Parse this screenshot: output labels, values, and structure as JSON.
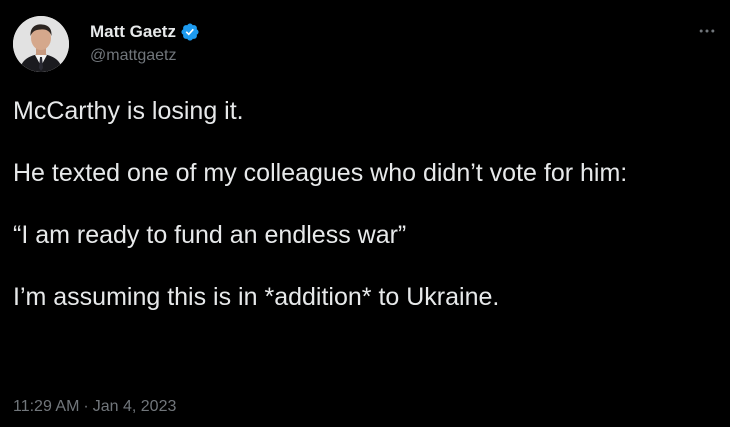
{
  "author": {
    "display_name": "Matt Gaetz",
    "handle": "@mattgaetz",
    "verified": true,
    "avatar_icon": "profile-photo"
  },
  "tweet": {
    "paragraphs": [
      "McCarthy is losing it.",
      "He texted one of my colleagues who didn’t vote for him:",
      "“I am ready to fund an endless war”",
      "I’m assuming this is in *addition* to Ukraine."
    ]
  },
  "meta": {
    "time": "11:29 AM",
    "separator": "·",
    "date": "Jan 4, 2023"
  },
  "icons": {
    "more": "more-options-icon",
    "verified": "verified-badge-icon"
  },
  "colors": {
    "background": "#000000",
    "text": "#e7e9ea",
    "secondary": "#71767b",
    "verified": "#1d9bf0"
  }
}
